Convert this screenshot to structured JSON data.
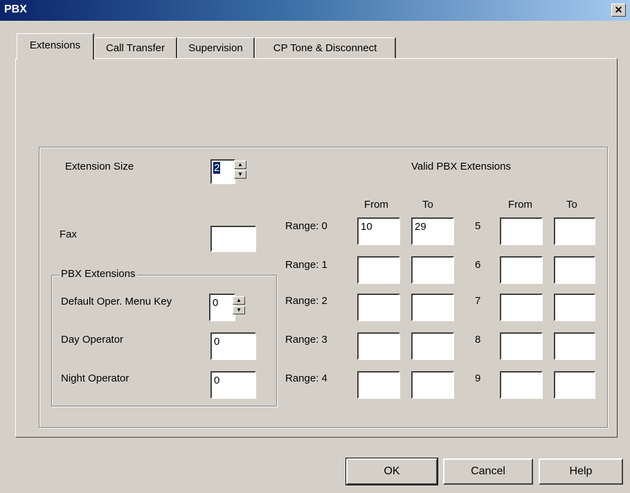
{
  "window": {
    "title": "PBX",
    "close_glyph": "✕"
  },
  "tabs": [
    {
      "label": "Extensions"
    },
    {
      "label": "Call Transfer"
    },
    {
      "label": "Supervision"
    },
    {
      "label": "CP Tone & Disconnect"
    }
  ],
  "left": {
    "extension_size_label": "Extension Size",
    "extension_size_value": "2",
    "fax_label": "Fax",
    "fax_value": "",
    "pbx_group_title": "PBX Extensions",
    "default_oper_label": "Default Oper. Menu Key",
    "default_oper_value": "0",
    "day_operator_label": "Day Operator",
    "day_operator_value": "0",
    "night_operator_label": "Night Operator",
    "night_operator_value": "0"
  },
  "ranges": {
    "title": "Valid PBX Extensions",
    "from_header": "From",
    "to_header": "To",
    "rows_left": [
      {
        "label": "Range: 0",
        "from": "10",
        "to": "29"
      },
      {
        "label": "Range: 1",
        "from": "",
        "to": ""
      },
      {
        "label": "Range: 2",
        "from": "",
        "to": ""
      },
      {
        "label": "Range: 3",
        "from": "",
        "to": ""
      },
      {
        "label": "Range: 4",
        "from": "",
        "to": ""
      }
    ],
    "rows_right": [
      {
        "label": "5",
        "from": "",
        "to": ""
      },
      {
        "label": "6",
        "from": "",
        "to": ""
      },
      {
        "label": "7",
        "from": "",
        "to": ""
      },
      {
        "label": "8",
        "from": "",
        "to": ""
      },
      {
        "label": "9",
        "from": "",
        "to": ""
      }
    ]
  },
  "buttons": {
    "ok": "OK",
    "cancel": "Cancel",
    "help": "Help"
  },
  "colors": {
    "face": "#d4d0c8",
    "title_start": "#0a246a",
    "title_end": "#a6caf0"
  }
}
